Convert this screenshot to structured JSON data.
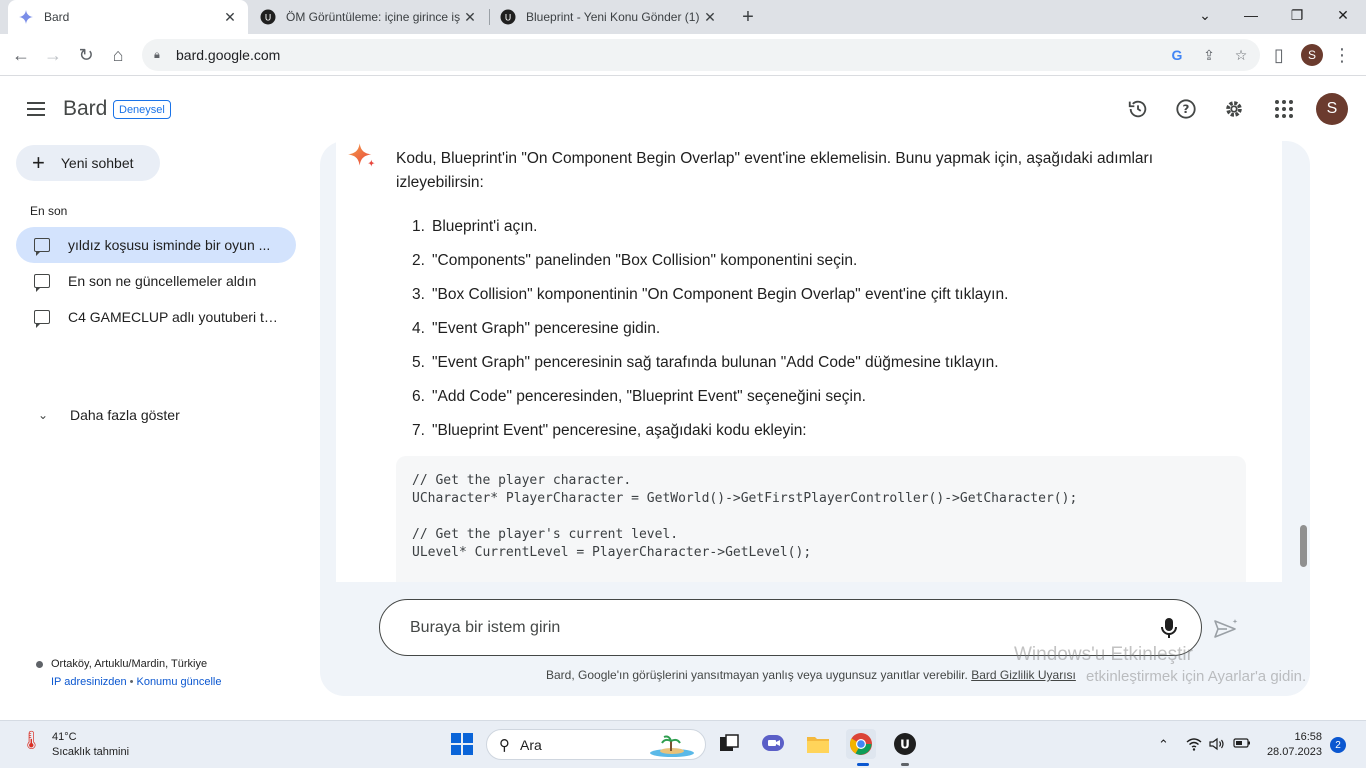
{
  "browser": {
    "tabs": [
      {
        "title": "Bard",
        "active": true
      },
      {
        "title": "ÖM Görüntüleme: içine girince iş",
        "active": false
      },
      {
        "title": "Blueprint - Yeni Konu Gönder (1)",
        "active": false
      }
    ],
    "url": "bard.google.com",
    "profile_initial": "S"
  },
  "app": {
    "brand": "Bard",
    "badge": "Deneysel",
    "avatar_initial": "S",
    "top_icons": [
      "history-icon",
      "help-icon",
      "settings-icon",
      "apps-grid-icon"
    ]
  },
  "sidebar": {
    "new_chat": "Yeni sohbet",
    "recent_heading": "En son",
    "history": [
      {
        "label": "yıldız koşusu isminde bir oyun ...",
        "active": true
      },
      {
        "label": "En son ne güncellemeler aldın",
        "active": false
      },
      {
        "label": "C4 GAMECLUP adlı youtuberi ta...",
        "active": false
      }
    ],
    "show_more": "Daha fazla göster",
    "location": "Ortaköy, Artuklu/Mardin, Türkiye",
    "location_links": [
      "IP adresinizden",
      "Konumu güncelle"
    ]
  },
  "response": {
    "intro": "Kodu, Blueprint'in \"On Component Begin Overlap\" event'ine eklemelisin. Bunu yapmak için, aşağıdaki adımları izleyebilirsin:",
    "steps": [
      "Blueprint'i açın.",
      "\"Components\" panelinden \"Box Collision\" komponentini seçin.",
      "\"Box Collision\" komponentinin \"On Component Begin Overlap\" event'ine çift tıklayın.",
      "\"Event Graph\" penceresine gidin.",
      "\"Event Graph\" penceresinin sağ tarafında bulunan \"Add Code\" düğmesine tıklayın.",
      "\"Add Code\" penceresinden, \"Blueprint Event\" seçeneğini seçin.",
      "\"Blueprint Event\" penceresine, aşağıdaki kodu ekleyin:"
    ],
    "code": "// Get the player character.\nUCharacter* PlayerCharacter = GetWorld()->GetFirstPlayerController()->GetCharacter();\n\n// Get the player's current level.\nULevel* CurrentLevel = PlayerCharacter->GetLevel();"
  },
  "prompt": {
    "placeholder": "Buraya bir istem girin",
    "disclaimer": "Bard, Google'ın görüşlerini yansıtmayan yanlış veya uygunsuz yanıtlar verebilir.",
    "privacy_link": "Bard Gizlilik Uyarısı"
  },
  "watermark": {
    "line1": "Windows'u Etkinleştir",
    "line2": "etkinleştirmek için Ayarlar'a gidin."
  },
  "taskbar": {
    "temperature": "41°C",
    "weather_label": "Sıcaklık tahmini",
    "search_label": "Ara",
    "time": "16:58",
    "date": "28.07.2023",
    "notifications": "2"
  },
  "colors": {
    "accent": "#1a73e8",
    "active_history": "#d3e3fd",
    "panel": "#f0f4f9",
    "avatar": "#6b3b2e"
  }
}
